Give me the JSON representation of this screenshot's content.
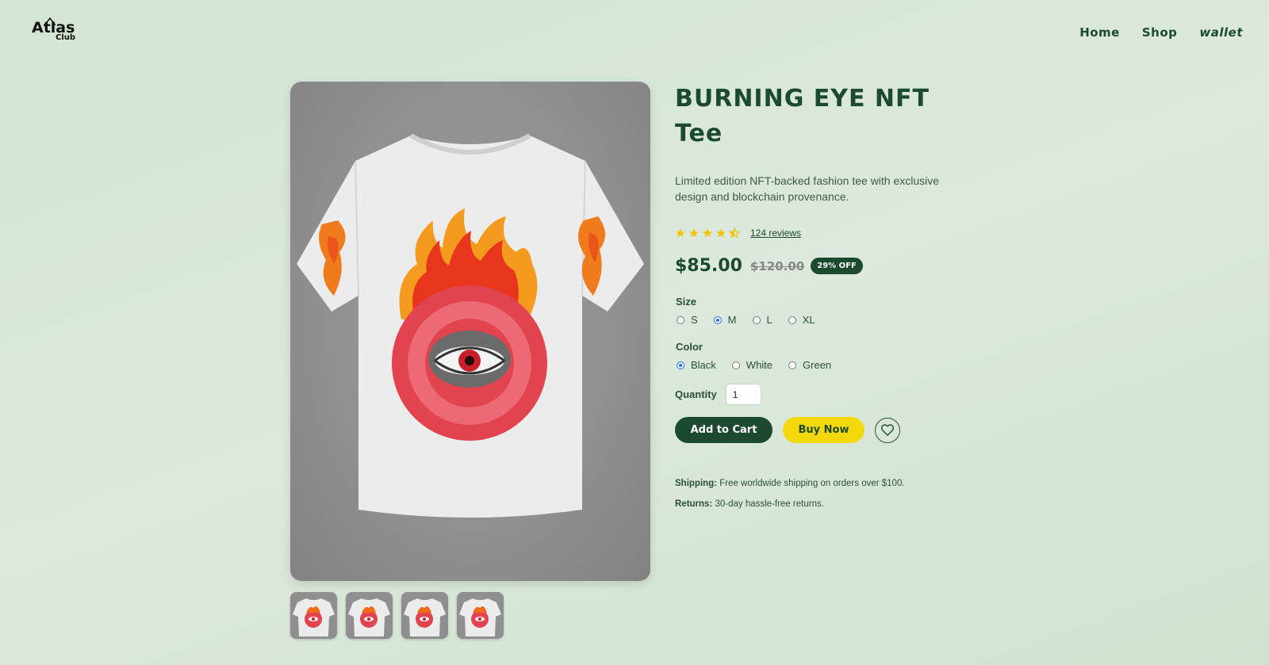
{
  "header": {
    "logo_text": "Atlas",
    "logo_sub": "Club",
    "nav": [
      {
        "label": "Home"
      },
      {
        "label": "Shop"
      },
      {
        "label": "wallet"
      }
    ]
  },
  "product": {
    "title_line1": "BURNING EYE NFT",
    "title_line2": "Tee",
    "description": "Limited edition NFT-backed fashion tee with exclusive design and blockchain provenance.",
    "rating": 4.5,
    "reviews_label": "124 reviews",
    "price": "$85.00",
    "old_price": "$120.00",
    "discount_badge": "29% OFF",
    "size_label": "Size",
    "sizes": [
      {
        "label": "S",
        "selected": false
      },
      {
        "label": "M",
        "selected": true
      },
      {
        "label": "L",
        "selected": false
      },
      {
        "label": "XL",
        "selected": false
      }
    ],
    "color_label": "Color",
    "colors": [
      {
        "label": "Black",
        "selected": true
      },
      {
        "label": "White",
        "selected": false
      },
      {
        "label": "Green",
        "selected": false
      }
    ],
    "quantity_label": "Quantity",
    "quantity_value": "1",
    "add_to_cart_label": "Add to Cart",
    "buy_now_label": "Buy Now",
    "shipping_label": "Shipping:",
    "shipping_text": " Free worldwide shipping on orders over $100.",
    "returns_label": "Returns:",
    "returns_text": " 30-day hassle-free returns."
  },
  "colors": {
    "brand_green": "#1b4a2e",
    "accent_yellow": "#f4d90a",
    "star": "#f4c20d"
  }
}
